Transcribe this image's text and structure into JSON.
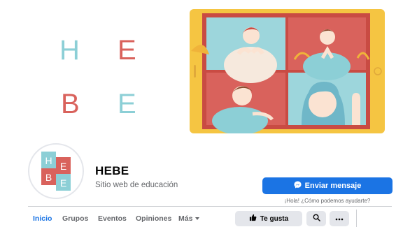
{
  "cover": {
    "letters": [
      {
        "char": "H",
        "color": "#8ccfd6"
      },
      {
        "char": "E",
        "color": "#d9625c"
      },
      {
        "char": "B",
        "color": "#d9625c"
      },
      {
        "char": "E",
        "color": "#8ccfd6"
      }
    ],
    "tablet_color": "#f5c542",
    "scene_colors": {
      "blue": "#9dd6dc",
      "red": "#d9625c",
      "frame": "#c94b43"
    }
  },
  "avatar": {
    "tiles": [
      {
        "char": "H",
        "bg": "#8ccfd6"
      },
      {
        "char": "E",
        "bg": "#d9625c"
      },
      {
        "char": "B",
        "bg": "#d9625c"
      },
      {
        "char": "E",
        "bg": "#8ccfd6"
      }
    ]
  },
  "page": {
    "name": "HEBE",
    "category": "Sitio web de educación"
  },
  "actions": {
    "message_label": "Enviar mensaje",
    "message_icon": "messenger-icon",
    "hint": "¡Hola! ¿Cómo podemos ayudarte?",
    "like_label": "Te gusta",
    "like_icon": "thumbs-up-icon",
    "search_icon": "search-icon",
    "more_icon": "ellipsis-icon"
  },
  "tabs": [
    {
      "label": "Inicio",
      "active": true
    },
    {
      "label": "Grupos",
      "active": false
    },
    {
      "label": "Eventos",
      "active": false
    },
    {
      "label": "Opiniones",
      "active": false
    },
    {
      "label": "Más",
      "active": false
    }
  ],
  "colors": {
    "accent": "#1b74e4",
    "button_gray": "#e4e6eb",
    "secondary_text": "#65676b"
  }
}
